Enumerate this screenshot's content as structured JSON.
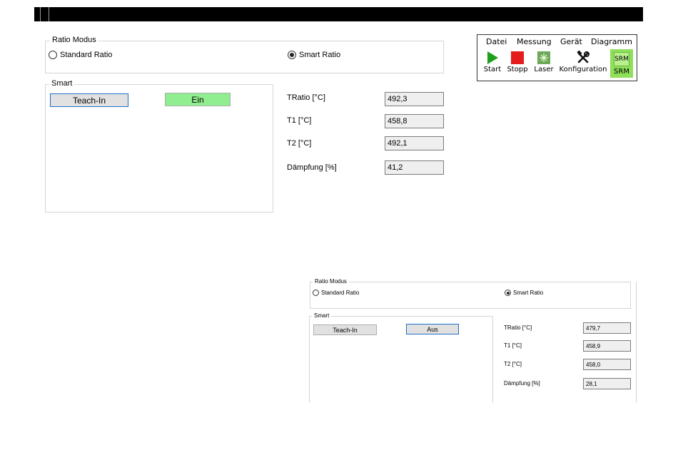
{
  "panel_large": {
    "ratio_group_label": "Ratio Modus",
    "radio_standard": "Standard Ratio",
    "radio_smart": "Smart Ratio",
    "smart_group_label": "Smart",
    "teach_in_button": "Teach-In",
    "toggle_button": "Ein",
    "fields": [
      {
        "label": "TRatio [°C]",
        "value": "492,3"
      },
      {
        "label": "T1 [°C]",
        "value": "458,8"
      },
      {
        "label": "T2 [°C]",
        "value": "492,1"
      },
      {
        "label": "Dämpfung [%]",
        "value": "41,2"
      }
    ]
  },
  "toolbar": {
    "menu": [
      "Datei",
      "Messung",
      "Gerät",
      "Diagramm"
    ],
    "tools": [
      {
        "label": "Start",
        "icon": "start-icon"
      },
      {
        "label": "Stopp",
        "icon": "stop-icon"
      },
      {
        "label": "Laser",
        "icon": "laser-icon"
      },
      {
        "label": "Konfiguration",
        "icon": "tools-icon"
      },
      {
        "label": "SRM",
        "icon": "srm-icon",
        "icon_text": "SRM"
      }
    ]
  },
  "panel_small": {
    "ratio_group_label": "Ratio Modus",
    "radio_standard": "Standard Ratio",
    "radio_smart": "Smart Ratio",
    "smart_group_label": "Smart",
    "teach_in_button": "Teach-In",
    "toggle_button": "Aus",
    "fields": [
      {
        "label": "TRatio [°C]",
        "value": "479,7"
      },
      {
        "label": "T1 [°C]",
        "value": "458,9"
      },
      {
        "label": "T2 [°C]",
        "value": "458,0"
      },
      {
        "label": "Dämpfung [%]",
        "value": "28,1"
      }
    ]
  },
  "colors": {
    "toggle_on": "#90ee90",
    "focus_border": "#1e6fc8",
    "start_green": "#1ea01e",
    "stop_red": "#e51c1c",
    "srm_bg": "#8ee05a"
  }
}
